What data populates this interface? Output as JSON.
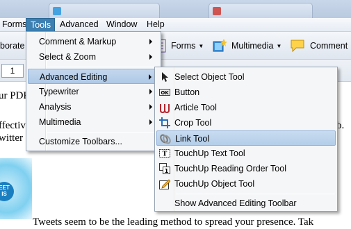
{
  "menubar": {
    "items": [
      "Forms",
      "Tools",
      "Advanced",
      "Window",
      "Help"
    ],
    "active": "Tools"
  },
  "toolbar": {
    "left_fragment": "borate",
    "forms_label": "Forms",
    "multimedia_label": "Multimedia",
    "comment_label": "Comment"
  },
  "nav": {
    "page_number": "1"
  },
  "document": {
    "line1": "ur PDF",
    "line2": "ffectiv",
    "line2_right": "b.",
    "line3": "witter",
    "bottom_line": "Tweets seem to be the leading method to spread your presence.  Tak",
    "badge_text": "EET\nIS"
  },
  "tools_menu": {
    "items": [
      {
        "label": "Comment & Markup",
        "submenu": true
      },
      {
        "label": "Select & Zoom",
        "submenu": true
      },
      {
        "label": "Advanced Editing",
        "submenu": true,
        "highlighted": true
      },
      {
        "label": "Typewriter",
        "submenu": true
      },
      {
        "label": "Analysis",
        "submenu": true
      },
      {
        "label": "Multimedia",
        "submenu": true
      },
      {
        "label": "Customize Toolbars...",
        "submenu": false
      }
    ]
  },
  "advanced_editing_menu": {
    "items": [
      {
        "label": "Select Object Tool",
        "icon": "arrow-pointer-icon"
      },
      {
        "label": "Button",
        "icon": "ok-button-icon"
      },
      {
        "label": "Article Tool",
        "icon": "article-icon"
      },
      {
        "label": "Crop Tool",
        "icon": "crop-icon"
      },
      {
        "label": "Link Tool",
        "icon": "link-icon",
        "highlighted": true
      },
      {
        "label": "TouchUp Text Tool",
        "icon": "touchup-text-icon"
      },
      {
        "label": "TouchUp Reading Order Tool",
        "icon": "reading-order-icon"
      },
      {
        "label": "TouchUp Object Tool",
        "icon": "touchup-object-icon"
      },
      {
        "label": "Show Advanced Editing Toolbar",
        "icon": ""
      }
    ]
  },
  "colors": {
    "menu_highlight": "#aec8e6",
    "active_menubar": "#3c7fb1",
    "menu_bg": "#f5f6f8"
  }
}
